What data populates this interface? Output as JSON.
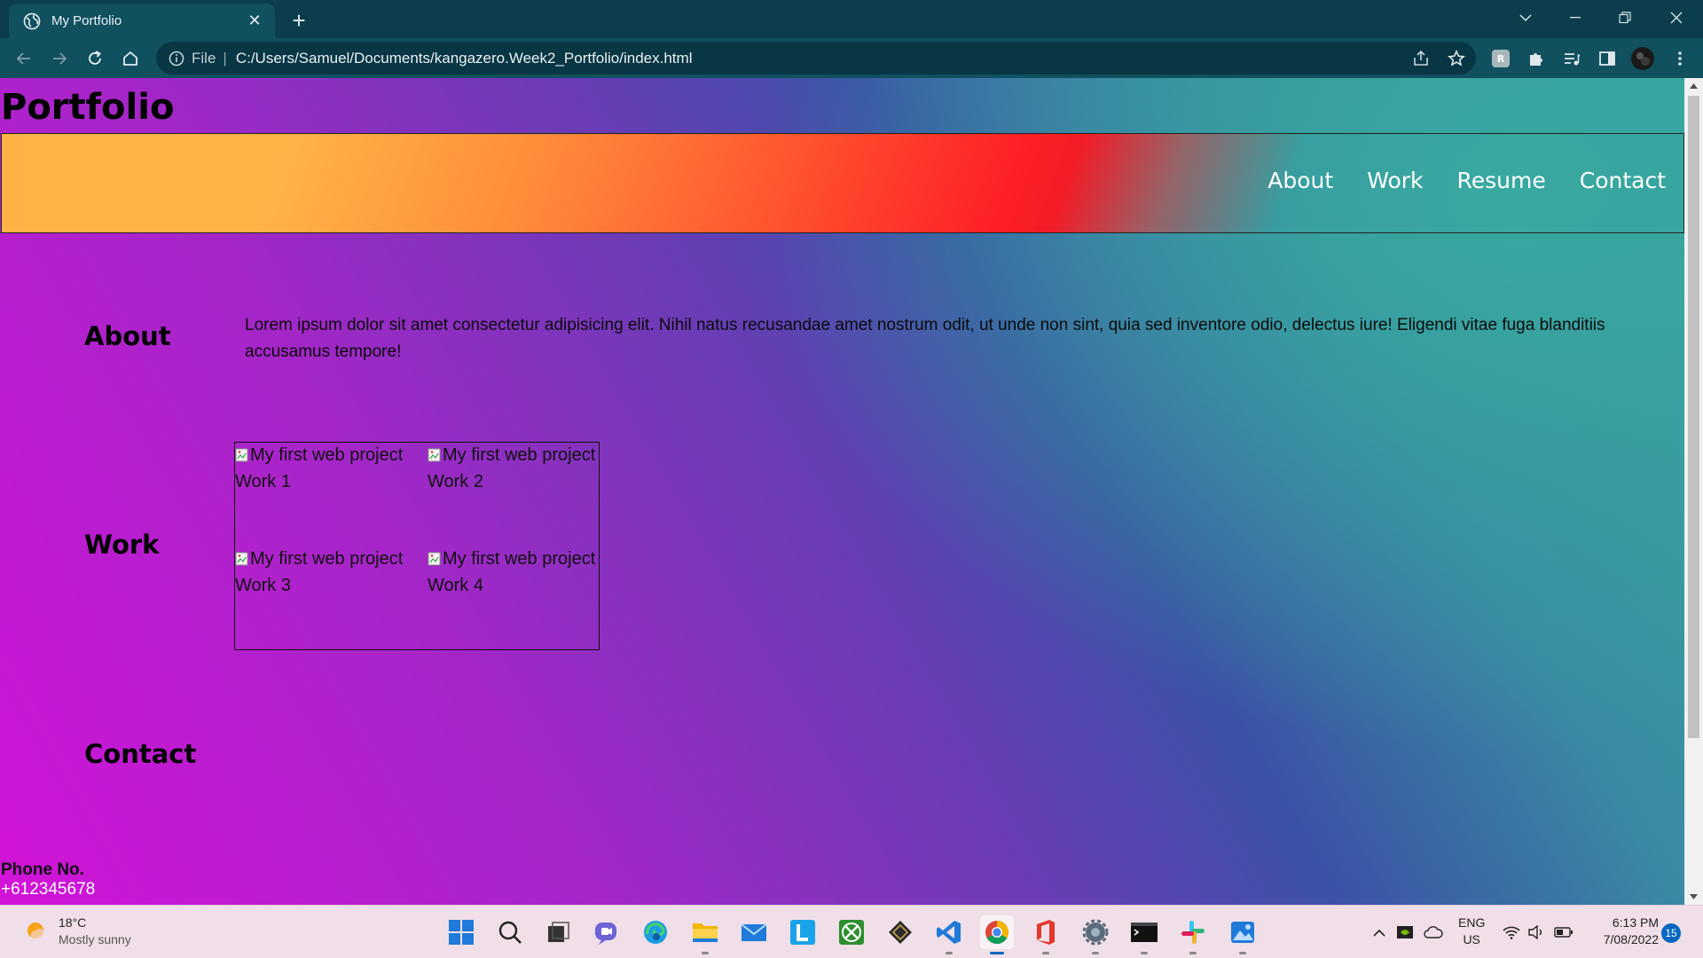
{
  "browser": {
    "tab_title": "My Portfolio",
    "address_scheme_label": "File",
    "address_url": "C:/Users/Samuel/Documents/kangazero.Week2_Portfolio/index.html"
  },
  "page": {
    "site_title": "Portfolio",
    "nav": [
      "About",
      "Work",
      "Resume",
      "Contact"
    ],
    "about": {
      "heading": "About",
      "text": "Lorem ipsum dolor sit amet consectetur adipisicing elit. Nihil natus recusandae amet nostrum odit, ut unde non sint, quia sed inventore odio, delectus iure! Eligendi vitae fuga blanditiis accusamus tempore!"
    },
    "work": {
      "heading": "Work",
      "items": [
        {
          "alt": "My first web project",
          "label": "Work 1"
        },
        {
          "alt": "My first web project",
          "label": "Work 2"
        },
        {
          "alt": "My first web project",
          "label": "Work 3"
        },
        {
          "alt": "My first web project",
          "label": "Work 4"
        }
      ]
    },
    "contact": {
      "heading": "Contact",
      "phone_label": "Phone No.",
      "phone_value": "+612345678"
    },
    "colors": {
      "nav_gradient_start": "#ffb347",
      "nav_gradient_red": "#ff1f26",
      "bg_magenta": "#d213d8",
      "bg_teal": "#3aa79f"
    }
  },
  "taskbar": {
    "weather_temp": "18°C",
    "weather_desc": "Mostly sunny",
    "lang_primary": "ENG",
    "lang_secondary": "US",
    "time": "6:13 PM",
    "date": "7/08/2022",
    "notification_count": "15",
    "apps": [
      "start-icon",
      "search-icon",
      "task-view-icon",
      "chat-icon",
      "edge-icon",
      "file-explorer-icon",
      "mail-icon",
      "l-app-icon",
      "xbox-icon",
      "game-app-icon",
      "vscode-icon",
      "chrome-icon",
      "office-icon",
      "settings-icon",
      "terminal-icon",
      "slack-icon",
      "photos-icon"
    ]
  }
}
